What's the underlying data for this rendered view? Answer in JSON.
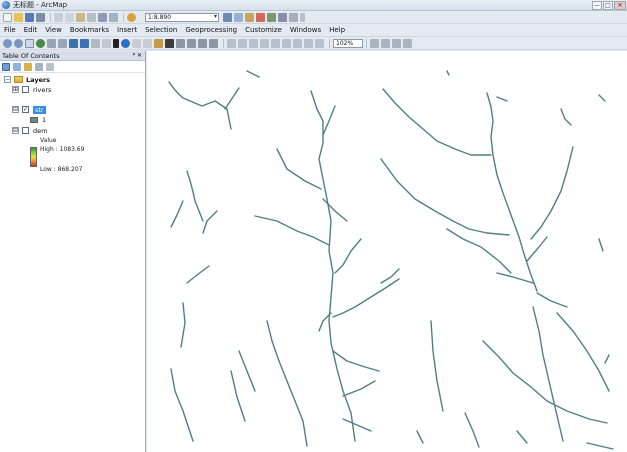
{
  "window": {
    "title": "无标题 - ArcMap",
    "minimize": "—",
    "maximize": "□",
    "close": "✕"
  },
  "toolbar": {
    "scale": "1:8,890",
    "zoom": "102%"
  },
  "menu": [
    "File",
    "Edit",
    "View",
    "Bookmarks",
    "Insert",
    "Selection",
    "Geoprocessing",
    "Customize",
    "Windows",
    "Help"
  ],
  "toc": {
    "title": "Table Of Contents",
    "pin": "ᵠ ✕",
    "root": "Layers",
    "layers": [
      {
        "name": "rivers",
        "expander": "⊞",
        "checked": ""
      },
      {
        "name": "str",
        "expander": "⊟",
        "checked": "✓",
        "class_label": "1"
      },
      {
        "name": "dem",
        "expander": "⊟",
        "checked": "",
        "value_label": "Value",
        "high": "High : 1083.69",
        "low": "Low : 868.207"
      }
    ]
  },
  "colors": {
    "river_stroke": "#4f7f86",
    "ramp_high": "#1f9b2e",
    "ramp_low": "#e02a1e"
  }
}
